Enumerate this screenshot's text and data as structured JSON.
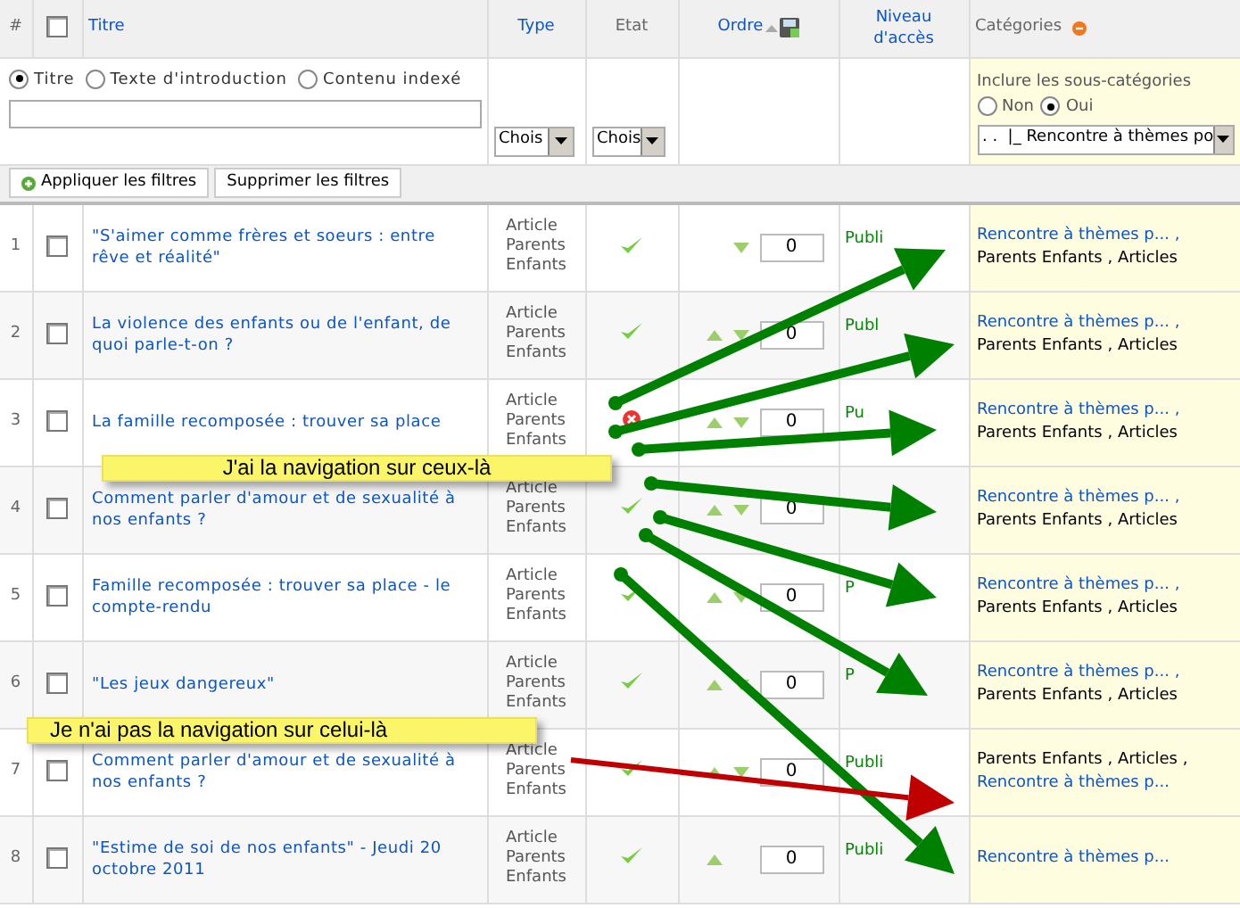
{
  "header": {
    "number": "#",
    "checked": false,
    "title": "Titre",
    "type": "Type",
    "state": "Etat",
    "order": "Ordre",
    "access": "Niveau d'accès",
    "categories": "Catégories"
  },
  "filters": {
    "search_in": [
      {
        "label": "Titre",
        "selected": true
      },
      {
        "label": "Texte d'introduction",
        "selected": false
      },
      {
        "label": "Contenu indexé",
        "selected": false
      }
    ],
    "type_select": "Chois",
    "state_select": "Chois",
    "subcategories": {
      "label": "Inclure les sous-catégories",
      "options": [
        {
          "label": "Non",
          "selected": false
        },
        {
          "label": "Oui",
          "selected": true
        }
      ]
    },
    "category_select": ". .  |_ Rencontre à thèmes po",
    "buttons": [
      "Appliquer les filtres",
      "Supprimer les filtres"
    ]
  },
  "rows": [
    {
      "number": "1",
      "checked": false,
      "title": "\"S'aimer comme frères et soeurs : entre rêve et réalité\"",
      "type": [
        "Article",
        "Parents",
        "Enfants"
      ],
      "published": true,
      "up": false,
      "down": true,
      "order": "0",
      "access": "Publi",
      "categories": [
        {
          "text": "Rencontre à thèmes p... ,",
          "link": true
        },
        {
          "text": "Parents Enfants , Articles",
          "link": false
        }
      ]
    },
    {
      "number": "2",
      "checked": false,
      "title": "La violence des enfants ou de l'enfant, de quoi parle-t-on ?",
      "type": [
        "Article",
        "Parents",
        "Enfants"
      ],
      "published": true,
      "up": true,
      "down": true,
      "order": "0",
      "access": "Publ",
      "categories": [
        {
          "text": "Rencontre à thèmes p... ,",
          "link": true
        },
        {
          "text": "Parents Enfants , Articles",
          "link": false
        }
      ]
    },
    {
      "number": "3",
      "checked": false,
      "title": "La famille recomposée : trouver sa place",
      "type": [
        "Article",
        "Parents",
        "Enfants"
      ],
      "published": false,
      "up": true,
      "down": true,
      "order": "0",
      "access": "Pu",
      "categories": [
        {
          "text": "Rencontre à thèmes p... ,",
          "link": true
        },
        {
          "text": "Parents Enfants , Articles",
          "link": false
        }
      ]
    },
    {
      "number": "4",
      "checked": false,
      "title": "Comment parler d'amour et de sexualité à nos enfants ?",
      "type": [
        "Article",
        "Parents",
        "Enfants"
      ],
      "published": true,
      "up": true,
      "down": true,
      "order": "0",
      "categories": [
        {
          "text": "Rencontre à thèmes p... ,",
          "link": true
        },
        {
          "text": "Parents Enfants , Articles",
          "link": false
        }
      ]
    },
    {
      "number": "5",
      "checked": false,
      "title": "Famille recomposée : trouver sa place - le compte-rendu",
      "type": [
        "Article",
        "Parents",
        "Enfants"
      ],
      "published": true,
      "up": true,
      "down": true,
      "order": "0",
      "access": "P",
      "categories": [
        {
          "text": "Rencontre à thèmes p... ,",
          "link": true
        },
        {
          "text": "Parents Enfants , Articles",
          "link": false
        }
      ]
    },
    {
      "number": "6",
      "checked": false,
      "title": "\"Les jeux dangereux\"",
      "type": [
        "Article",
        "Parents",
        "Enfants"
      ],
      "published": true,
      "up": true,
      "down": true,
      "order": "0",
      "access": "P",
      "categories": [
        {
          "text": "Rencontre à thèmes p... ,",
          "link": true
        },
        {
          "text": "Parents Enfants , Articles",
          "link": false
        }
      ]
    },
    {
      "number": "7",
      "checked": false,
      "title": "Comment parler d'amour et de sexualité à nos enfants ?",
      "type": [
        "Article",
        "Parents",
        "Enfants"
      ],
      "published": true,
      "up": true,
      "down": true,
      "order": "0",
      "access": "Publi",
      "categories": [
        {
          "text": "Parents Enfants , Articles ,",
          "link": false
        },
        {
          "text": "Rencontre à thèmes p...",
          "link": true
        }
      ]
    },
    {
      "number": "8",
      "checked": false,
      "title": "\"Estime de soi de nos enfants\" - Jeudi 20 octobre 2011",
      "type": [
        "Article",
        "Parents",
        "Enfants"
      ],
      "published": true,
      "up": true,
      "down": false,
      "order": "0",
      "access": "Publi",
      "categories": [
        {
          "text": "Rencontre à thèmes p...",
          "link": true
        }
      ]
    }
  ],
  "annotations": [
    {
      "text": "J'ai la navigation sur ceux-là",
      "kind": "works"
    },
    {
      "text": "Je n'ai pas la navigation sur celui-là",
      "kind": "fails"
    }
  ]
}
